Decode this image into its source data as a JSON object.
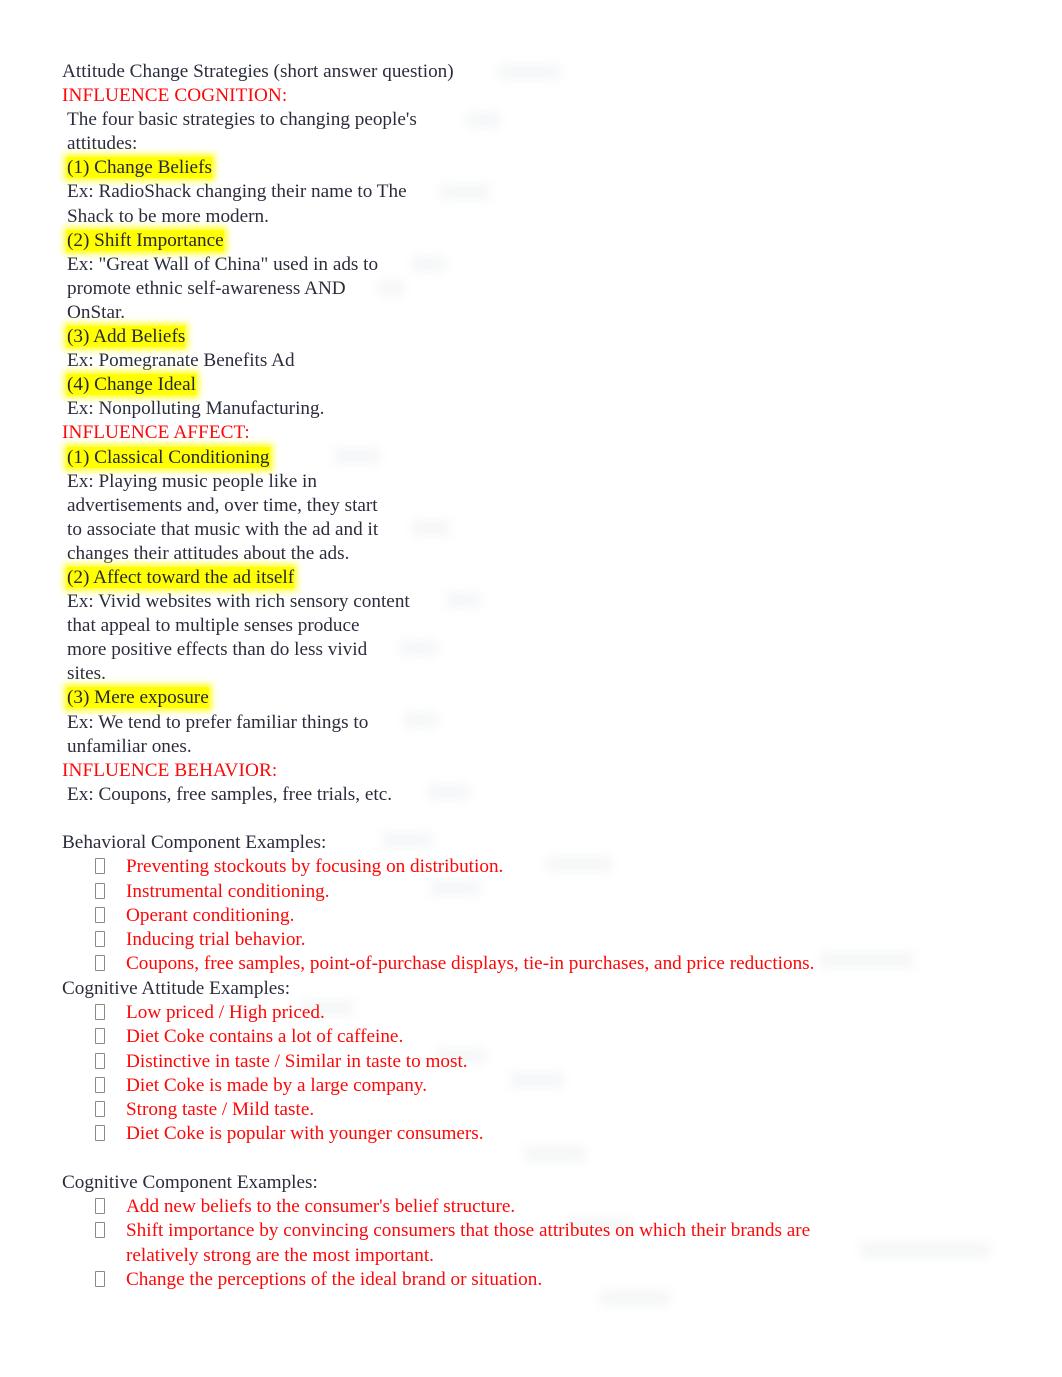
{
  "document": {
    "title": "Attitude Change Strategies (short answer question)",
    "colors": {
      "body_text": "#2b2d3c",
      "accent_red": "#fc0808",
      "highlight_yellow": "#ffff00",
      "page_background": "#ffffff",
      "bullet_marker": "#8a8a8a"
    },
    "bullet_glyph": "⎕"
  },
  "top_block": {
    "lines": [
      {
        "id": "title",
        "text": "Attitude Change Strategies (short answer question)",
        "style": "plain",
        "indent": false
      },
      {
        "id": "influence-cognition-heading",
        "text": "INFLUENCE COGNITION:",
        "style": "red",
        "indent": false
      },
      {
        "id": "four-strategies-1",
        "text": "The four basic strategies to changing people's",
        "style": "plain",
        "indent": true
      },
      {
        "id": "four-strategies-2",
        "text": "attitudes:",
        "style": "plain",
        "indent": true
      },
      {
        "id": "strategy-1",
        "text": "(1) Change Beliefs",
        "style": "highlight",
        "indent": true
      },
      {
        "id": "strategy-1-ex-1",
        "text": "Ex: RadioShack changing their name to The",
        "style": "plain",
        "indent": true
      },
      {
        "id": "strategy-1-ex-2",
        "text": "Shack to be more modern.",
        "style": "plain",
        "indent": true
      },
      {
        "id": "strategy-2",
        "text": "(2) Shift Importance",
        "style": "highlight",
        "indent": true
      },
      {
        "id": "strategy-2-ex-1",
        "text": "Ex: \"Great Wall of China\" used in ads to",
        "style": "plain",
        "indent": true
      },
      {
        "id": "strategy-2-ex-2",
        "text": "promote ethnic self-awareness AND",
        "style": "plain",
        "indent": true
      },
      {
        "id": "strategy-2-ex-3",
        "text": "OnStar.",
        "style": "plain",
        "indent": true
      },
      {
        "id": "strategy-3",
        "text": "(3) Add Beliefs",
        "style": "highlight",
        "indent": true
      },
      {
        "id": "strategy-3-ex-1",
        "text": "Ex: Pomegranate Benefits Ad",
        "style": "plain",
        "indent": true
      },
      {
        "id": "strategy-4",
        "text": "(4) Change Ideal",
        "style": "highlight",
        "indent": true
      },
      {
        "id": "strategy-4-ex-1",
        "text": "Ex: Nonpolluting Manufacturing.",
        "style": "plain",
        "indent": true
      },
      {
        "id": "influence-affect-heading",
        "text": "INFLUENCE AFFECT:",
        "style": "red",
        "indent": false
      },
      {
        "id": "affect-1",
        "text": "(1) Classical Conditioning",
        "style": "highlight",
        "indent": true
      },
      {
        "id": "affect-1-ex-1",
        "text": "Ex: Playing music people like in",
        "style": "plain",
        "indent": true
      },
      {
        "id": "affect-1-ex-2",
        "text": "advertisements and, over time, they start",
        "style": "plain",
        "indent": true
      },
      {
        "id": "affect-1-ex-3",
        "text": "to associate that music with the ad and it",
        "style": "plain",
        "indent": true
      },
      {
        "id": "affect-1-ex-4",
        "text": "changes their attitudes about the ads.",
        "style": "plain",
        "indent": true
      },
      {
        "id": "affect-2",
        "text": "(2) Affect toward the ad itself",
        "style": "highlight",
        "indent": true
      },
      {
        "id": "affect-2-ex-1",
        "text": "Ex: Vivid websites with rich sensory content",
        "style": "plain",
        "indent": true
      },
      {
        "id": "affect-2-ex-2",
        "text": "that appeal to multiple senses produce",
        "style": "plain",
        "indent": true
      },
      {
        "id": "affect-2-ex-3",
        "text": "more positive effects than do less vivid",
        "style": "plain",
        "indent": true
      },
      {
        "id": "affect-2-ex-4",
        "text": "sites.",
        "style": "plain",
        "indent": true
      },
      {
        "id": "affect-3",
        "text": "(3) Mere exposure",
        "style": "highlight",
        "indent": true
      },
      {
        "id": "affect-3-ex-1",
        "text": "Ex: We tend to prefer familiar things to",
        "style": "plain",
        "indent": true
      },
      {
        "id": "affect-3-ex-2",
        "text": "unfamiliar ones.",
        "style": "plain",
        "indent": true
      },
      {
        "id": "influence-behavior-heading",
        "text": "INFLUENCE BEHAVIOR:",
        "style": "red",
        "indent": false
      },
      {
        "id": "behavior-ex-1",
        "text": "Ex: Coupons, free samples, free trials, etc.",
        "style": "plain",
        "indent": true
      }
    ]
  },
  "sections": [
    {
      "id": "behavioral-component",
      "title": "Behavioral Component Examples:",
      "bullets": [
        "Preventing stockouts by focusing on distribution.",
        "Instrumental conditioning.",
        "Operant conditioning.",
        "Inducing trial behavior.",
        "Coupons, free samples, point-of-purchase displays, tie-in purchases, and price reductions."
      ]
    },
    {
      "id": "cognitive-attitude",
      "title": "Cognitive Attitude Examples:",
      "bullets": [
        "Low priced / High priced.",
        "Diet Coke contains a lot of caffeine.",
        "Distinctive in taste / Similar in taste to most.",
        "Diet Coke is made by a large company.",
        "Strong taste / Mild taste.",
        "Diet Coke is popular with younger consumers."
      ]
    },
    {
      "id": "cognitive-component",
      "title": "Cognitive Component Examples:",
      "bullets": [
        "Add new beliefs to the consumer's belief structure.",
        "Shift importance by convincing consumers that those attributes on which their brands are relatively strong are the most important.",
        "Change the perceptions of the ideal brand or situation."
      ]
    }
  ]
}
